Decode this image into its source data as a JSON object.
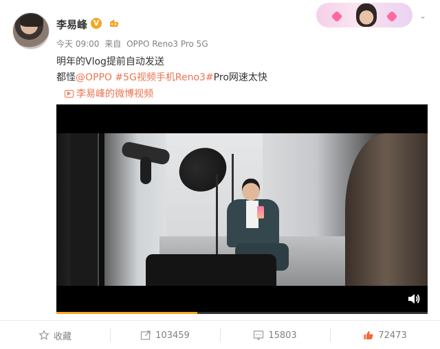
{
  "user": {
    "name": "李易峰",
    "verified_badge": "V",
    "avatar_icon": "avatar"
  },
  "meta": {
    "time": "今天 09:00",
    "from_label": "来自",
    "device": "OPPO Reno3 Pro 5G"
  },
  "post": {
    "line1": "明年的Vlog提前自动发送",
    "line2_prefix": "都怪",
    "mention": "@OPPO",
    "hashtag": "#5G视频手机Reno3#",
    "line2_suffix": "Pro网速太快",
    "video_link": "李易峰的微博视频"
  },
  "player": {
    "progress": 0.38,
    "accent_color": "#f5a623"
  },
  "actions": {
    "favorite_label": "收藏",
    "repost_count": "103459",
    "comment_count": "15803",
    "like_count": "72473"
  },
  "colors": {
    "link": "#eb7350",
    "meta": "#808080"
  }
}
